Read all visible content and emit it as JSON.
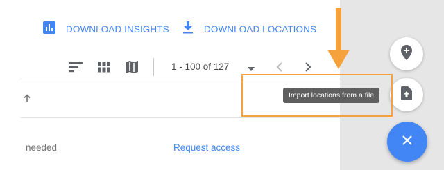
{
  "actions": {
    "download_insights": "DOWNLOAD INSIGHTS",
    "download_locations": "DOWNLOAD LOCATIONS"
  },
  "toolbar": {
    "icons": [
      "sort-icon",
      "grid-view-icon",
      "map-view-icon"
    ]
  },
  "pagination": {
    "range_text": "1 - 100 of 127"
  },
  "table": {
    "rows": [
      {
        "status": "needed",
        "action": "Request access"
      }
    ]
  },
  "fabs": {
    "tooltip": "Import locations from a file"
  },
  "colors": {
    "accent": "#4285f4",
    "annotation": "#f5a13c",
    "tooltip_bg": "#5f5f5f",
    "side_panel": "#e6e6e6"
  }
}
